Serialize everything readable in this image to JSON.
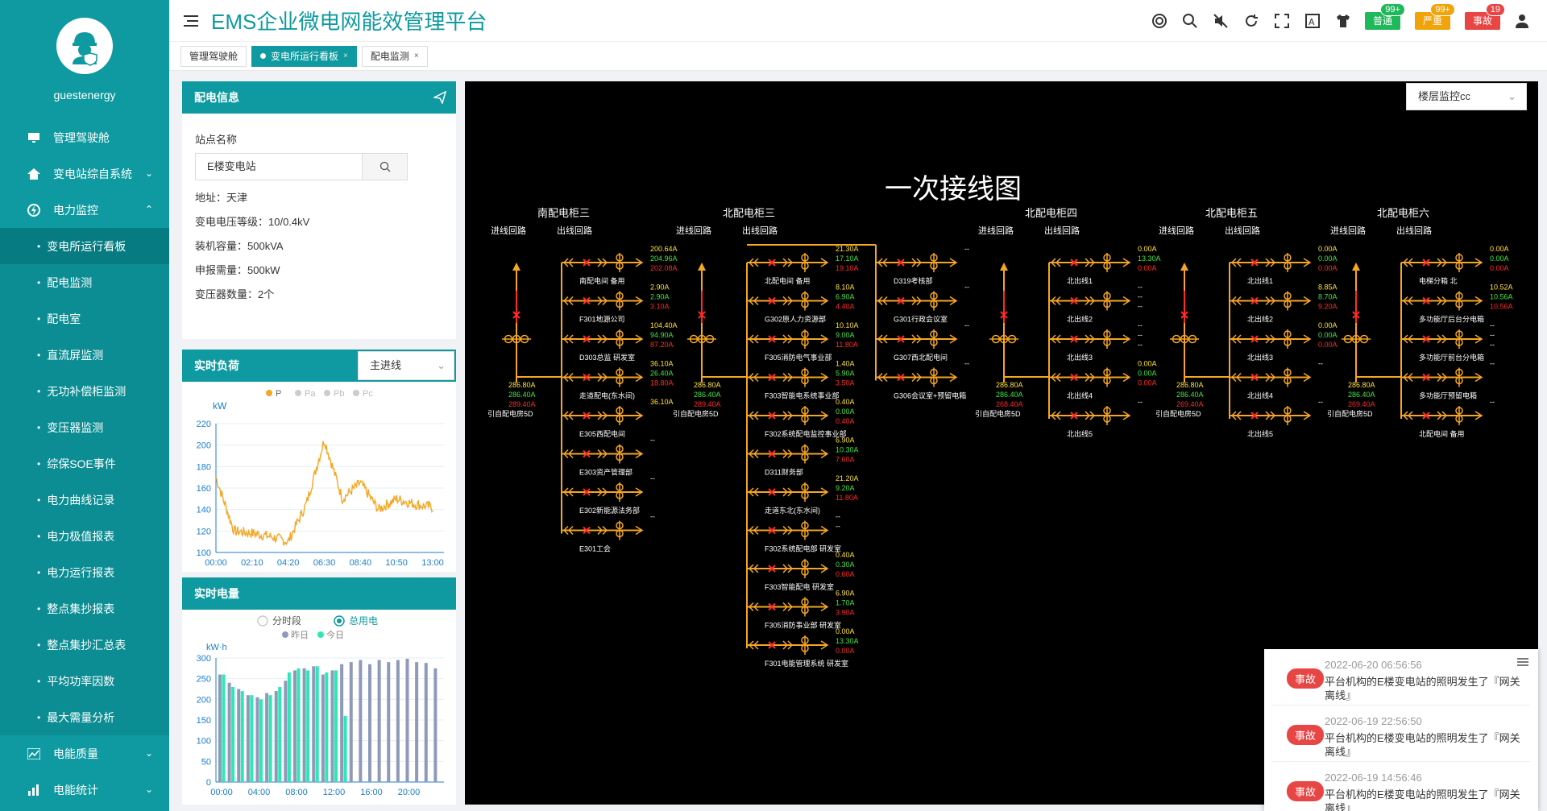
{
  "sidebar": {
    "username": "guestenergy",
    "items": [
      {
        "label": "管理驾驶舱",
        "icon": "monitor-icon"
      },
      {
        "label": "变电站综自系统",
        "icon": "home-icon",
        "chev": "⌄"
      },
      {
        "label": "电力监控",
        "icon": "power-icon",
        "chev": "⌃"
      }
    ],
    "sub_items": [
      "变电所运行看板",
      "配电监测",
      "配电室",
      "直流屏监测",
      "无功补偿柜监测",
      "变压器监测",
      "综保SOE事件",
      "电力曲线记录",
      "电力极值报表",
      "电力运行报表",
      "整点集抄报表",
      "整点集抄汇总表",
      "平均功率因数",
      "最大需量分析"
    ],
    "bottom_items": [
      {
        "label": "电能质量",
        "icon": "chart-icon",
        "chev": "⌄"
      },
      {
        "label": "电能统计",
        "icon": "bar-icon",
        "chev": "⌄"
      }
    ]
  },
  "header": {
    "title": "EMS企业微电网能效管理平台",
    "alarms": [
      {
        "label": "普通",
        "count": "99+",
        "color": "#1fb85a"
      },
      {
        "label": "严重",
        "count": "99+",
        "color": "#f0a30a"
      },
      {
        "label": "事故",
        "count": "19",
        "color": "#e84545"
      }
    ]
  },
  "tabs": [
    {
      "label": "管理驾驶舱",
      "close": ""
    },
    {
      "label": "变电所运行看板",
      "close": "×"
    },
    {
      "label": "配电监测",
      "close": "×"
    }
  ],
  "info": {
    "title": "配电信息",
    "station_label": "站点名称",
    "station_value": "E楼变电站",
    "lines": [
      "地址：天津",
      "变电电压等级：10/0.4kV",
      "装机容量：500kVA",
      "申报需量：500kW",
      "变压器数量：2个"
    ]
  },
  "load": {
    "title": "实时负荷",
    "select": "主进线",
    "legend": [
      "P",
      "Pa",
      "Pb",
      "Pc"
    ],
    "unit": "kW",
    "y_ticks": [
      "220",
      "200",
      "180",
      "160",
      "140",
      "120",
      "100"
    ],
    "x_ticks": [
      "00:00",
      "02:10",
      "04:20",
      "06:30",
      "08:40",
      "10:50",
      "13:00"
    ]
  },
  "energy": {
    "title": "实时电量",
    "radio": [
      "分时段",
      "总用电"
    ],
    "legend": [
      "昨日",
      "今日"
    ],
    "unit": "kW·h",
    "y_ticks": [
      "300",
      "250",
      "200",
      "150",
      "100",
      "50",
      "0"
    ],
    "x_ticks": [
      "00:00",
      "04:00",
      "08:00",
      "12:00",
      "16:00",
      "20:00"
    ]
  },
  "chart_data": [
    {
      "type": "line",
      "title": "",
      "ylabel": "kW",
      "ylim": [
        100,
        220
      ],
      "x": [
        "00:00",
        "02:10",
        "04:20",
        "06:30",
        "08:40",
        "10:50",
        "13:00"
      ],
      "series": [
        {
          "name": "P",
          "values": [
            170,
            120,
            118,
            115,
            110,
            145,
            205,
            150,
            165,
            140,
            150,
            145,
            142
          ]
        }
      ]
    },
    {
      "type": "bar",
      "title": "",
      "ylabel": "kW·h",
      "ylim": [
        0,
        300
      ],
      "categories": [
        "00:00",
        "04:00",
        "08:00",
        "12:00",
        "16:00",
        "20:00"
      ],
      "series": [
        {
          "name": "昨日",
          "values": [
            260,
            240,
            225,
            210,
            205,
            215,
            220,
            245,
            270,
            275,
            280,
            260,
            270,
            285,
            290,
            295,
            285,
            295,
            290,
            295,
            298,
            290,
            288,
            275
          ]
        },
        {
          "name": "今日",
          "values": [
            260,
            230,
            220,
            210,
            200,
            210,
            230,
            265,
            275,
            270,
            280,
            265,
            270,
            160
          ]
        }
      ]
    }
  ],
  "diagram": {
    "title": "一次接线图",
    "floor_select": "楼层监控cc",
    "incoming_label": "进线回路",
    "outgoing_label": "出线回路",
    "cabinets": [
      {
        "name": "南配电柜三",
        "in": [
          "286.80A",
          "286.40A",
          "289.40A"
        ],
        "in_name": "引自配电房5D",
        "outs": [
          {
            "name": "南配电间 备用",
            "v": [
              "200.64A",
              "204.96A",
              "202.08A"
            ]
          },
          {
            "name": "F301地源公司",
            "v": [
              "2.90A",
              "2.90A",
              "3.10A"
            ]
          },
          {
            "name": "D303总监 研发室",
            "v": [
              "104.40A",
              "94.90A",
              "87.20A"
            ]
          },
          {
            "name": "走道配电(东水间)",
            "v": [
              "36.10A",
              "26.40A",
              "18.80A"
            ]
          },
          {
            "name": "E305西配电间",
            "v": [
              "36.10A"
            ]
          },
          {
            "name": "E303资产管理部",
            "v": [
              "--"
            ]
          },
          {
            "name": "E302新能源法务部",
            "v": [
              "--"
            ]
          },
          {
            "name": "E301工会",
            "v": [
              "--"
            ]
          }
        ]
      },
      {
        "name": "北配电柜三",
        "in": [
          "286.80A",
          "286.40A",
          "289.40A"
        ],
        "in_name": "引自配电房5D",
        "outs": [
          {
            "name": "北配电间 备用",
            "v": [
              "21.30A",
              "17.10A",
              "19.10A"
            ]
          },
          {
            "name": "G302原人力资源部",
            "v": [
              "8.10A",
              "6.90A",
              "4.40A"
            ]
          },
          {
            "name": "F305消防电气事业部",
            "v": [
              "10.10A",
              "9.00A",
              "11.80A"
            ]
          },
          {
            "name": "F303智能电系统事业部",
            "v": [
              "1.40A",
              "5.90A",
              "3.50A"
            ]
          },
          {
            "name": "F302系统配电监控事业部",
            "v": [
              "0.40A",
              "0.00A",
              "0.40A"
            ]
          },
          {
            "name": "D311财务部",
            "v": [
              "6.90A",
              "10.30A",
              "7.60A"
            ]
          },
          {
            "name": "走道东北(东水间)",
            "v": [
              "21.20A",
              "9.20A",
              "11.80A"
            ]
          },
          {
            "name": "F302系统配电部 研发室",
            "v": [
              "--",
              "--"
            ]
          },
          {
            "name": "F303智能配电 研发室",
            "v": [
              "0.40A",
              "0.30A",
              "0.60A"
            ]
          },
          {
            "name": "F305消防事业部 研发室",
            "v": [
              "6.90A",
              "1.70A",
              "3.90A"
            ]
          },
          {
            "name": "F301电能管理系统 研发室",
            "v": [
              "0.00A",
              "13.30A",
              "0.00A"
            ]
          }
        ],
        "outs2": [
          {
            "name": "D319考核部",
            "v": [
              "--"
            ]
          },
          {
            "name": "G301行政会议室",
            "v": [
              "--"
            ]
          },
          {
            "name": "G307西北配电间",
            "v": [
              "--"
            ]
          },
          {
            "name": "G306会议室+预留电箱",
            "v": [
              "--"
            ]
          }
        ]
      },
      {
        "name": "北配电柜四",
        "in": [
          "286.80A",
          "286.40A",
          "268.40A"
        ],
        "in_name": "引自配电房5D",
        "outs": [
          {
            "name": "北出线1",
            "v": [
              "0.00A",
              "13.30A",
              "0.00A"
            ]
          },
          {
            "name": "北出线2",
            "v": [
              "--",
              "--",
              "--"
            ]
          },
          {
            "name": "北出线3",
            "v": [
              "--",
              "--",
              "--"
            ]
          },
          {
            "name": "北出线4",
            "v": [
              "0.00A",
              "0.00A",
              "0.00A"
            ]
          },
          {
            "name": "北出线5",
            "v": [
              "--"
            ]
          }
        ]
      },
      {
        "name": "北配电柜五",
        "in": [
          "286.80A",
          "286.40A",
          "269.40A"
        ],
        "in_name": "引自配电房5D",
        "outs": [
          {
            "name": "北出线1",
            "v": [
              "0.00A",
              "0.00A",
              "0.00A"
            ]
          },
          {
            "name": "北出线2",
            "v": [
              "8.85A",
              "8.70A",
              "9.20A"
            ]
          },
          {
            "name": "北出线3",
            "v": [
              "0.00A",
              "0.00A",
              "0.00A"
            ]
          },
          {
            "name": "北出线4",
            "v": [
              "--"
            ]
          },
          {
            "name": "北出线5",
            "v": [
              "--"
            ]
          }
        ]
      },
      {
        "name": "北配电柜六",
        "in": [
          "286.80A",
          "286.40A",
          "269.40A"
        ],
        "in_name": "引自配电房5D",
        "outs": [
          {
            "name": "电梯分箱 北",
            "v": [
              "0.00A",
              "0.00A",
              "0.00A"
            ]
          },
          {
            "name": "多功能厅后台分电箱",
            "v": [
              "10.52A",
              "10.56A",
              "10.56A"
            ]
          },
          {
            "name": "多功能厅前台分电箱",
            "v": [
              "--",
              "--",
              "--"
            ]
          },
          {
            "name": "多功能厅预留电箱",
            "v": [
              "--"
            ]
          },
          {
            "name": "北配电间 备用",
            "v": [
              "--"
            ]
          }
        ]
      }
    ]
  },
  "events": [
    {
      "time": "2022-06-20 06:56:56",
      "badge": "事故",
      "msg": "平台机构的E楼变电站的照明发生了『网关离线』"
    },
    {
      "time": "2022-06-19 22:56:50",
      "badge": "事故",
      "msg": "平台机构的E楼变电站的照明发生了『网关离线』"
    },
    {
      "time": "2022-06-19 14:56:46",
      "badge": "事故",
      "msg": "平台机构的E楼变电站的照明发生了『网关离线』"
    }
  ]
}
